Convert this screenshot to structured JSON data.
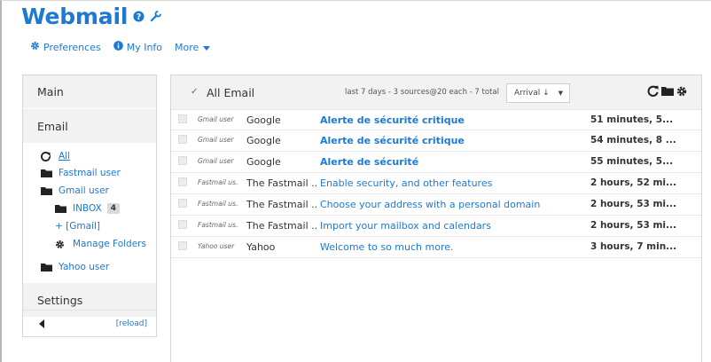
{
  "app": {
    "title": "Webmail"
  },
  "nav": {
    "preferences": "Preferences",
    "myinfo": "My Info",
    "more": "More"
  },
  "sidebar": {
    "main_label": "Main",
    "email_label": "Email",
    "settings_label": "Settings",
    "reload_label": "[reload]",
    "tree": {
      "all": "All",
      "fastmail": "Fastmail user",
      "gmail": "Gmail user",
      "inbox": "INBOX",
      "inbox_count": "4",
      "gmail_folder": "+ [Gmail]",
      "manage": "Manage Folders",
      "yahoo": "Yahoo user"
    }
  },
  "list": {
    "header": "All Email",
    "meta": "last 7 days - 3 sources@20 each - 7 total",
    "sort": "Arrival ↓",
    "messages": [
      {
        "account": "Gmail user",
        "from": "Google",
        "subject": "Alerte de sécurité critique",
        "when": "51 minutes, 5...",
        "unread": true
      },
      {
        "account": "Gmail user",
        "from": "Google",
        "subject": "Alerte de sécurité critique",
        "when": "54 minutes, 8 ...",
        "unread": true
      },
      {
        "account": "Gmail user",
        "from": "Google",
        "subject": "Alerte de sécurité",
        "when": "55 minutes, 5...",
        "unread": true
      },
      {
        "account": "Fastmail us...",
        "from": "The Fastmail ...",
        "subject": "Enable security, and other features",
        "when": "2 hours, 52 mi...",
        "unread": false
      },
      {
        "account": "Fastmail us...",
        "from": "The Fastmail ...",
        "subject": "Choose your address with a personal domain",
        "when": "2 hours, 53 mi...",
        "unread": false
      },
      {
        "account": "Fastmail us...",
        "from": "The Fastmail ...",
        "subject": "Import your mailbox and calendars",
        "when": "2 hours, 53 mi...",
        "unread": false
      },
      {
        "account": "Yahoo user",
        "from": "Yahoo",
        "subject": "Welcome to so much more.",
        "when": "3 hours, 7 min...",
        "unread": false
      }
    ]
  },
  "colors": {
    "accent": "#1e79d3",
    "panel": "#f2f2f2"
  },
  "icons": [
    "question-icon",
    "wrench-icon",
    "gear-icon",
    "info-icon",
    "caret-down-icon",
    "refresh-icon",
    "folder-icon",
    "left-arrow-icon",
    "all-icon"
  ]
}
